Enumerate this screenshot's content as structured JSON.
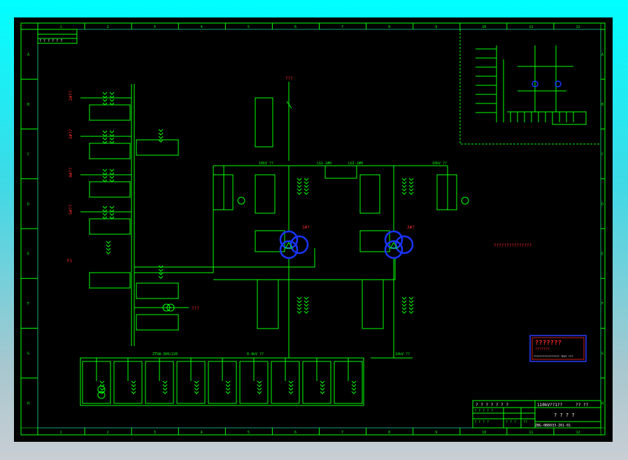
{
  "grid": {
    "columns": [
      "1",
      "2",
      "3",
      "4",
      "5",
      "6",
      "7",
      "8",
      "9",
      "10",
      "11",
      "12"
    ],
    "rows": [
      "A",
      "B",
      "C",
      "D",
      "E",
      "F",
      "G",
      "H"
    ]
  },
  "corner_box_text": "? ? ? ? ? ?",
  "colors": {
    "wire": "#00ff00",
    "tag": "#ff2a2a",
    "transformer": "#1a35ff",
    "frame": "#0000ff",
    "text": "#ffffff"
  },
  "labels": {
    "source_top": "???",
    "t1": "1#?",
    "t2": "2#?",
    "bus_left": "LG1-2#0",
    "bus_right": "LG1-2#0",
    "bus_10kv_left": "10kV ??",
    "bus_10kv_right": "10kV ??",
    "note_red": "???????????????",
    "side_unit": "???",
    "feeders_left": [
      "2#??",
      "3#??",
      "4#??",
      "5#??"
    ],
    "f_label": "F1",
    "lv_bus_left": "ZTSW-380/220",
    "lv_bus_mid": "0.4kV ??",
    "lv_bus_right": "10kV ??"
  },
  "stamp": {
    "title": "???????",
    "line2": "???????",
    "subtitle": "?????????????????  TEXT ???"
  },
  "title_block": {
    "project": "? ? ? ? ? ? ?",
    "drawing": "110kV??1??",
    "scale": "?? ??",
    "name": "? ? ? ?",
    "number": "ZBG-0B8033-Z01-01",
    "row_a": "? ? ? ? ?",
    "row_b": "? ? ? ?",
    "cell_a": "? ? ?",
    "cell_b": "??"
  }
}
